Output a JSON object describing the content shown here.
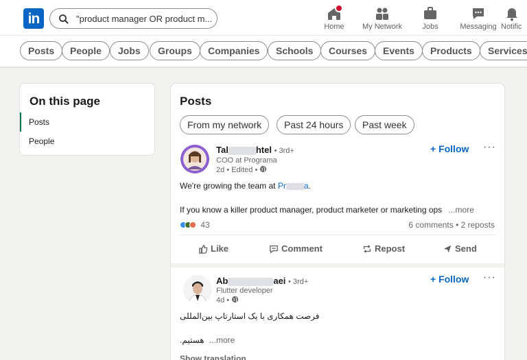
{
  "header": {
    "logo_text": "in",
    "search_value": "\"product manager OR product m...",
    "nav": [
      {
        "label": "Home",
        "icon": "home-icon"
      },
      {
        "label": "My Network",
        "icon": "network-icon"
      },
      {
        "label": "Jobs",
        "icon": "briefcase-icon"
      },
      {
        "label": "Messaging",
        "icon": "message-icon"
      },
      {
        "label": "Notific",
        "icon": "bell-icon"
      }
    ]
  },
  "filters": [
    "Posts",
    "People",
    "Jobs",
    "Groups",
    "Companies",
    "Schools",
    "Courses",
    "Events",
    "Products",
    "Services"
  ],
  "sidebar": {
    "title": "On this page",
    "items": [
      "Posts",
      "People"
    ]
  },
  "main": {
    "title": "Posts",
    "chips": [
      "From my network",
      "Past 24 hours",
      "Past week"
    ],
    "posts": [
      {
        "name_start": "Tal",
        "name_end": "htel",
        "degree": "• 3rd+",
        "headline": "COO at Programa",
        "meta": "2d • Edited •",
        "follow": "+ Follow",
        "text1_prefix": "We're growing the team at ",
        "text1_link": "Pr",
        "text1_link_end": "a",
        "text1_suffix": ".",
        "text2": "If you know a killer product manager, product marketer or marketing ops",
        "more": "...more",
        "reactions": "43",
        "counts": "6 comments • 2 reposts",
        "actions": [
          "Like",
          "Comment",
          "Repost",
          "Send"
        ]
      },
      {
        "name_start": "Ab",
        "name_end": "aei",
        "degree": "• 3rd+",
        "headline": "Flutter developer",
        "meta": "4d •",
        "follow": "+ Follow",
        "text1": "فرصت همکاری با یک استارتاپ بین‌المللی",
        "text2": "هستیم.",
        "more": "...more",
        "show_translation": "Show translation"
      }
    ]
  },
  "colors": {
    "accent": "#0a66c2",
    "active_green": "#01754f",
    "notification": "#cb112d"
  }
}
